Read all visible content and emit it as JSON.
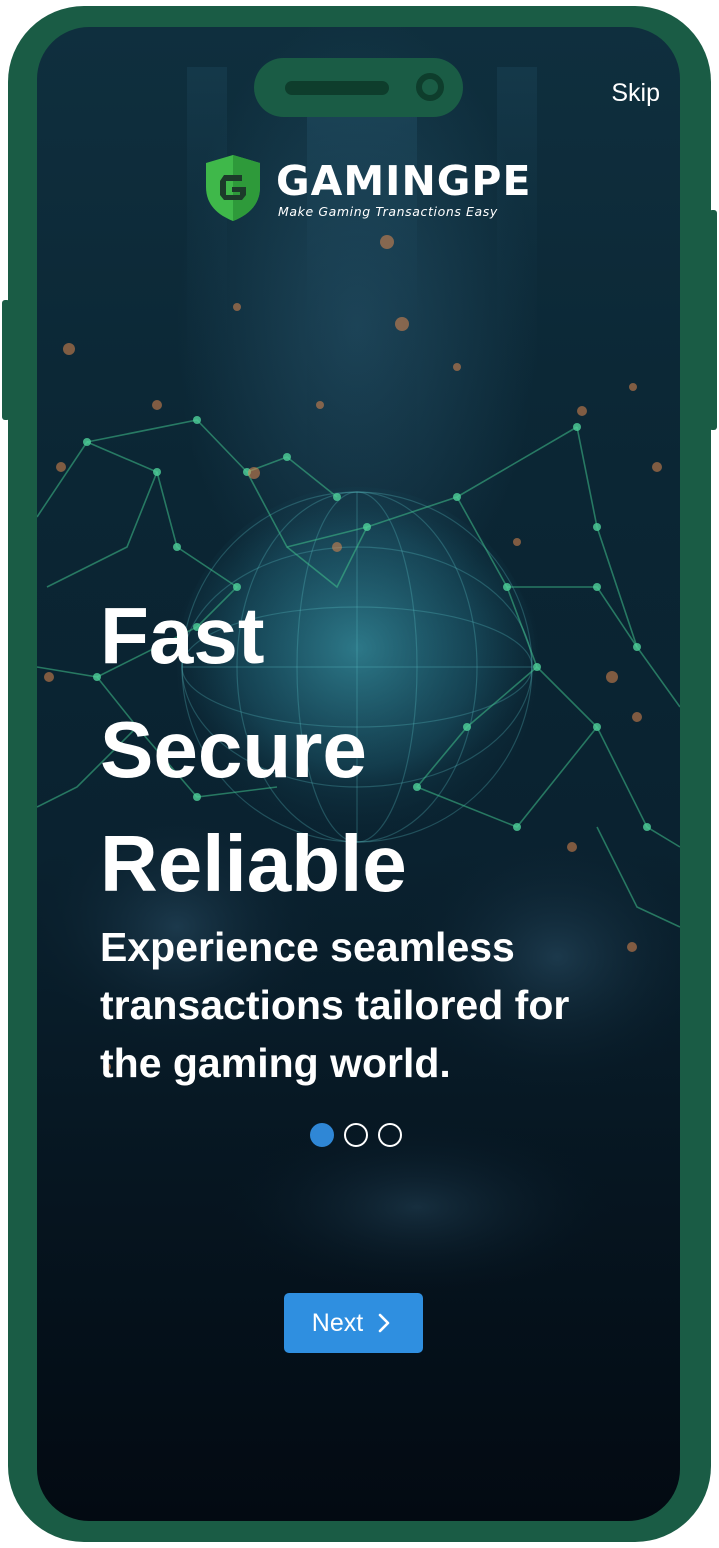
{
  "header": {
    "skip_label": "Skip"
  },
  "logo": {
    "name": "GAMINGPE",
    "tagline": "Make Gaming Transactions Easy",
    "icon": "shield-g-icon",
    "shield_color": "#3fb84a"
  },
  "headline": {
    "lines": [
      "Fast",
      "Secure",
      "Reliable"
    ]
  },
  "subtitle": {
    "lines": [
      "Experience seamless",
      "transactions tailored for",
      "the gaming world."
    ]
  },
  "pager": {
    "total": 3,
    "active_index": 0,
    "active_color": "#2f87d6"
  },
  "next_button": {
    "label": "Next",
    "icon": "chevron-right-icon",
    "color": "#2f8fe0"
  },
  "frame": {
    "color": "#1a5c45"
  }
}
